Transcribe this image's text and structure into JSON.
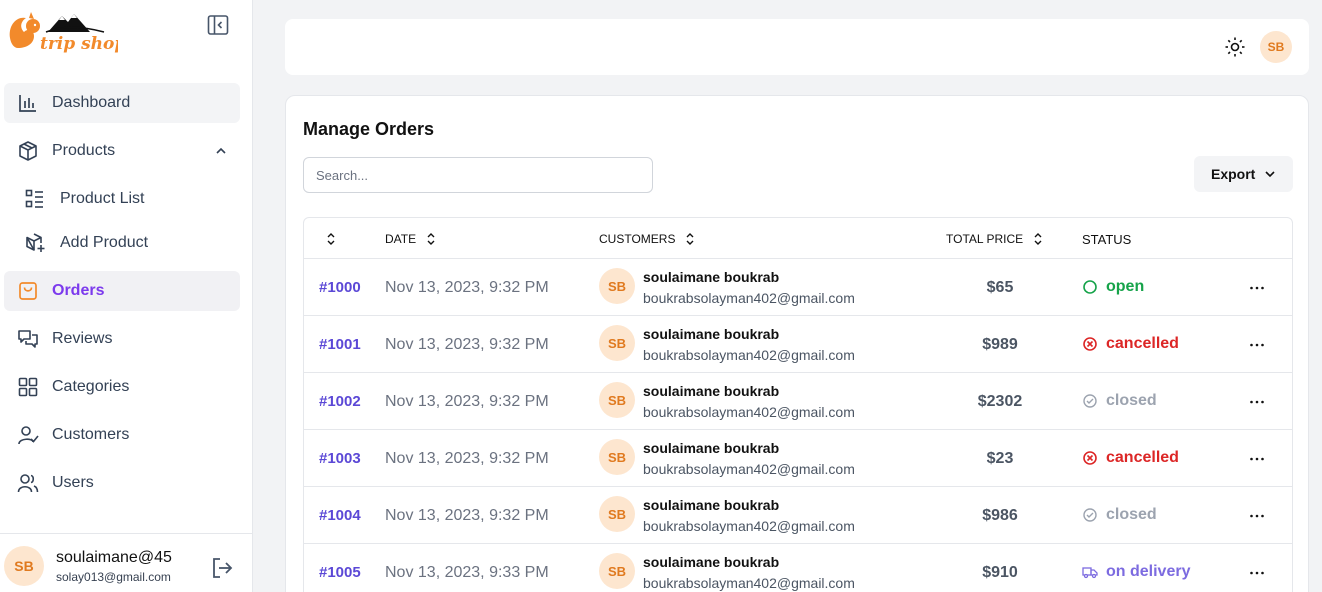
{
  "brand": {
    "name": "trip shop",
    "color": "#f28a2b"
  },
  "sidebar": {
    "items": [
      {
        "label": "Dashboard",
        "icon": "bar-chart-icon"
      },
      {
        "label": "Products",
        "icon": "box-icon"
      },
      {
        "label": "Product List",
        "icon": "list-icon"
      },
      {
        "label": "Add Product",
        "icon": "box-plus-icon"
      },
      {
        "label": "Orders",
        "icon": "shopping-bag-icon"
      },
      {
        "label": "Reviews",
        "icon": "chat-icon"
      },
      {
        "label": "Categories",
        "icon": "grid-icon"
      },
      {
        "label": "Customers",
        "icon": "user-check-icon"
      },
      {
        "label": "Users",
        "icon": "users-icon"
      }
    ],
    "user": {
      "initials": "SB",
      "name": "soulaimane@45",
      "email": "solay013@gmail.com"
    }
  },
  "topbar": {
    "avatar": "SB"
  },
  "orders": {
    "title": "Manage Orders",
    "search_placeholder": "Search...",
    "export_label": "Export",
    "columns": {
      "date": "DATE",
      "customers": "CUSTOMERS",
      "total": "TOTAL PRICE",
      "status": "STATUS"
    },
    "rows": [
      {
        "id": "#1000",
        "date": "Nov 13, 2023, 9:32 PM",
        "initials": "SB",
        "name": "soulaimane boukrab",
        "email": "boukrabsolayman402@gmail.com",
        "price": "$65",
        "status": "open"
      },
      {
        "id": "#1001",
        "date": "Nov 13, 2023, 9:32 PM",
        "initials": "SB",
        "name": "soulaimane boukrab",
        "email": "boukrabsolayman402@gmail.com",
        "price": "$989",
        "status": "cancelled"
      },
      {
        "id": "#1002",
        "date": "Nov 13, 2023, 9:32 PM",
        "initials": "SB",
        "name": "soulaimane boukrab",
        "email": "boukrabsolayman402@gmail.com",
        "price": "$2302",
        "status": "closed"
      },
      {
        "id": "#1003",
        "date": "Nov 13, 2023, 9:32 PM",
        "initials": "SB",
        "name": "soulaimane boukrab",
        "email": "boukrabsolayman402@gmail.com",
        "price": "$23",
        "status": "cancelled"
      },
      {
        "id": "#1004",
        "date": "Nov 13, 2023, 9:32 PM",
        "initials": "SB",
        "name": "soulaimane boukrab",
        "email": "boukrabsolayman402@gmail.com",
        "price": "$986",
        "status": "closed"
      },
      {
        "id": "#1005",
        "date": "Nov 13, 2023, 9:33 PM",
        "initials": "SB",
        "name": "soulaimane boukrab",
        "email": "boukrabsolayman402@gmail.com",
        "price": "$910",
        "status": "on delivery"
      }
    ]
  },
  "status_colors": {
    "open": "#16a34a",
    "cancelled": "#dc2626",
    "closed": "#9ca3af",
    "on delivery": "#7c6be0"
  },
  "accent": "#7c3aed"
}
